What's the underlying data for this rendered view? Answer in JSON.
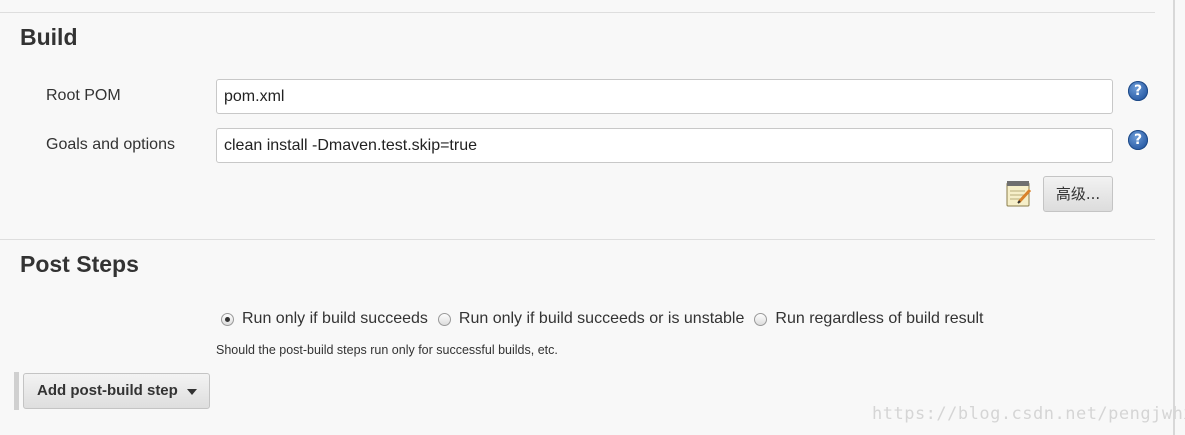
{
  "build": {
    "title": "Build",
    "root_pom_label": "Root POM",
    "root_pom_value": "pom.xml",
    "goals_label": "Goals and options",
    "goals_value": "clean install -Dmaven.test.skip=true",
    "help_glyph": "?",
    "advanced_label": "高级..."
  },
  "post_steps": {
    "title": "Post Steps",
    "options": [
      {
        "label": "Run only if build succeeds",
        "checked": true
      },
      {
        "label": "Run only if build succeeds or is unstable",
        "checked": false
      },
      {
        "label": "Run regardless of build result",
        "checked": false
      }
    ],
    "hint": "Should the post-build steps run only for successful builds, etc.",
    "add_button_label": "Add post-build step"
  },
  "watermark": "https://blog.csdn.net/pengjwhx",
  "icons": {
    "help": "help-icon",
    "notepad": "notepad-icon",
    "caret": "caret-down-icon"
  }
}
